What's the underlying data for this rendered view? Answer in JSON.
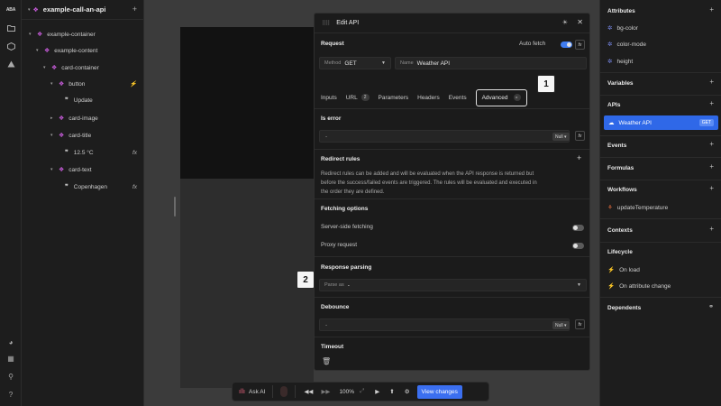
{
  "rail": {
    "logo": "ABA"
  },
  "layers": {
    "project_name": "example-call-an-api",
    "tree": [
      {
        "label": "example-container",
        "indent": 0,
        "type": "component",
        "chevron": "▾"
      },
      {
        "label": "example-content",
        "indent": 1,
        "type": "component",
        "chevron": "▾"
      },
      {
        "label": "card-container",
        "indent": 2,
        "type": "component",
        "chevron": "▾"
      },
      {
        "label": "button",
        "indent": 3,
        "type": "component",
        "chevron": "▾",
        "right": "⚡"
      },
      {
        "label": "Update",
        "indent": 4,
        "type": "text",
        "chevron": ""
      },
      {
        "label": "card-image",
        "indent": 3,
        "type": "component",
        "chevron": "▸"
      },
      {
        "label": "card-title",
        "indent": 3,
        "type": "component",
        "chevron": "▾"
      },
      {
        "label": "12.5 °C",
        "indent": 4,
        "type": "text",
        "chevron": "",
        "right": "fx"
      },
      {
        "label": "card-text",
        "indent": 3,
        "type": "component",
        "chevron": "▾"
      },
      {
        "label": "Copenhagen",
        "indent": 4,
        "type": "text",
        "chevron": "",
        "right": "fx"
      }
    ]
  },
  "modal": {
    "title": "Edit API",
    "request": {
      "section": "Request",
      "auto_fetch_label": "Auto fetch",
      "method_label": "Method",
      "method_value": "GET",
      "name_label": "Name",
      "name_value": "Weather API"
    },
    "tabs": [
      {
        "label": "Inputs"
      },
      {
        "label": "URL",
        "badge": "2"
      },
      {
        "label": "Parameters"
      },
      {
        "label": "Headers"
      },
      {
        "label": "Events"
      }
    ],
    "active_tab": "Advanced",
    "is_error": {
      "section": "Is error",
      "value": "-",
      "null_label": "Null"
    },
    "redirect": {
      "section": "Redirect rules",
      "text": "Redirect rules can be added and will be evaluated when the API response is returned but before the success/failed events are triggered. The rules will be evaluated and executed in the order they are defined."
    },
    "fetching": {
      "section": "Fetching options",
      "server_side": "Server-side fetching",
      "proxy": "Proxy request"
    },
    "parsing": {
      "section": "Response parsing",
      "parse_label": "Parse as",
      "parse_value": "-"
    },
    "debounce": {
      "section": "Debounce",
      "value": "-",
      "null_label": "Null"
    },
    "timeout": {
      "section": "Timeout"
    }
  },
  "callouts": {
    "one": "1",
    "two": "2"
  },
  "toolbar": {
    "ask_ai": "Ask AI",
    "zoom": "100%",
    "view_changes": "View changes"
  },
  "props": {
    "attributes_title": "Attributes",
    "attributes": [
      "bg-color",
      "color-mode",
      "height"
    ],
    "variables_title": "Variables",
    "apis_title": "APIs",
    "api_name": "Weather API",
    "api_method": "GET",
    "events_title": "Events",
    "formulas_title": "Formulas",
    "workflows_title": "Workflows",
    "workflow_name": "updateTemperature",
    "contexts_title": "Contexts",
    "lifecycle_title": "Lifecycle",
    "lifecycle": [
      "On load",
      "On attribute change"
    ],
    "dependents_title": "Dependents"
  },
  "colors": {
    "accent": "#3f7cf0",
    "component": "#c55bd8",
    "workflow": "#e06a3b"
  }
}
